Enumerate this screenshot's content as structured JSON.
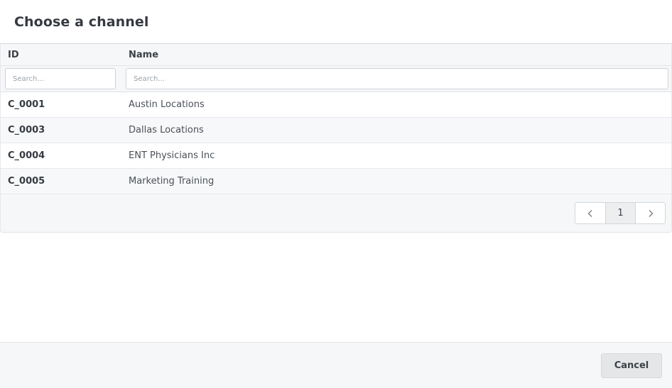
{
  "dialog": {
    "title": "Choose a channel"
  },
  "table": {
    "columns": {
      "id": "ID",
      "name": "Name"
    },
    "filters": {
      "id_placeholder": "Search...",
      "name_placeholder": "Search...",
      "id_value": "",
      "name_value": ""
    },
    "rows": [
      {
        "id": "C_0001",
        "name": "Austin Locations"
      },
      {
        "id": "C_0003",
        "name": "Dallas Locations"
      },
      {
        "id": "C_0004",
        "name": "ENT Physicians Inc"
      },
      {
        "id": "C_0005",
        "name": "Marketing Training"
      }
    ]
  },
  "pagination": {
    "current_page": "1",
    "prev_icon": "chevron-left-icon",
    "next_icon": "chevron-right-icon"
  },
  "footer": {
    "cancel_label": "Cancel"
  }
}
